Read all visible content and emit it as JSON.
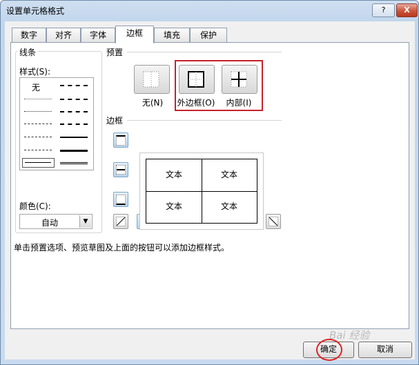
{
  "window": {
    "title": "设置单元格格式",
    "help_label": "?",
    "close_label": "X"
  },
  "tabs": [
    {
      "label": "数字"
    },
    {
      "label": "对齐"
    },
    {
      "label": "字体"
    },
    {
      "label": "边框",
      "active": true
    },
    {
      "label": "填充"
    },
    {
      "label": "保护"
    }
  ],
  "line": {
    "group_label": "线条",
    "style_label": "样式(S):",
    "none_label": "无",
    "color_label": "颜色(C):",
    "color_value": "自动"
  },
  "presets": {
    "group_label": "预置",
    "items": [
      {
        "label": "无(N)",
        "icon": "border-none-icon"
      },
      {
        "label": "外边框(O)",
        "icon": "border-outline-icon"
      },
      {
        "label": "内部(I)",
        "icon": "border-inside-icon"
      }
    ]
  },
  "border": {
    "group_label": "边框",
    "preview_cells": [
      "文本",
      "文本",
      "文本",
      "文本"
    ]
  },
  "hint": "单击预置选项、预览草图及上面的按钮可以添加边框样式。",
  "buttons": {
    "ok": "确定",
    "cancel": "取消"
  },
  "watermark": "Bai 经验",
  "colors": {
    "highlight": "#c8202a",
    "accent": "#7fa8c9"
  }
}
